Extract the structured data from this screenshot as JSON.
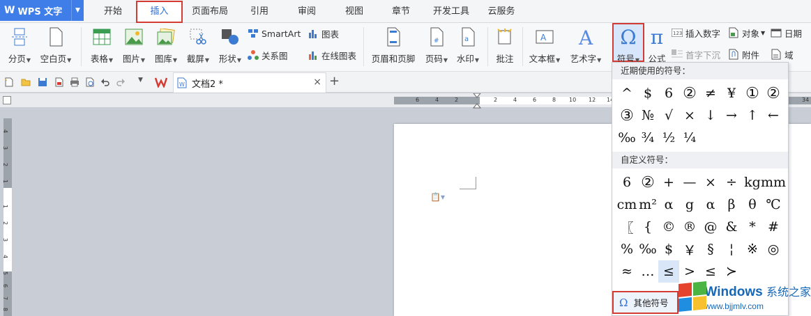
{
  "app": {
    "name": "WPS 文字",
    "logo": "W"
  },
  "menu_tabs": [
    "开始",
    "插入",
    "页面布局",
    "引用",
    "审阅",
    "视图",
    "章节",
    "开发工具",
    "云服务"
  ],
  "active_tab": "插入",
  "ribbon": {
    "blank": "分页",
    "blank_page": "空白页",
    "table": "表格",
    "picture": "图片",
    "gallery": "图库",
    "screenshot": "截屏",
    "shape": "形状",
    "smartart": "SmartArt",
    "relation": "关系图",
    "chart": "图表",
    "online_chart": "在线图表",
    "header_footer": "页眉和页脚",
    "page_num": "页码",
    "watermark": "水印",
    "comment": "批注",
    "textbox": "文本框",
    "wordart": "艺术字",
    "symbol": "符号",
    "formula": "公式",
    "insert_number": "插入数字",
    "drop_cap": "首字下沉",
    "object": "对象",
    "attachment": "附件",
    "date": "日期",
    "field": "域"
  },
  "document_tab": {
    "name": "文档2 *",
    "close": "×",
    "new": "+"
  },
  "ruler": {
    "h_numbers": [
      "6",
      "4",
      "2",
      "2",
      "4",
      "6",
      "8",
      "10",
      "12",
      "14",
      "34"
    ],
    "v_numbers": [
      "4",
      "3",
      "2",
      "1",
      "1",
      "2",
      "3",
      "4",
      "5",
      "6",
      "7",
      "8"
    ]
  },
  "symbol_panel": {
    "recent_title": "近期使用的符号：",
    "recent": [
      "^",
      "$",
      "6",
      "②",
      "≠",
      "¥",
      "①",
      "②",
      "③",
      "№",
      "√",
      "×",
      "↓",
      "→",
      "↑",
      "←",
      "‰",
      "¾",
      "½",
      "¼"
    ],
    "custom_title": "自定义符号：",
    "custom": [
      "6",
      "②",
      "+",
      "—",
      "×",
      "÷",
      "kg",
      "mm",
      "cm",
      "m²",
      "α",
      "g",
      "α",
      "β",
      "θ",
      "℃",
      "〖",
      "{",
      "©",
      "®",
      "@",
      "&",
      "*",
      "#",
      "%",
      "‰",
      "$",
      "￥",
      "§",
      "¦",
      "※",
      "◎",
      "≈",
      "…",
      "≤",
      ">",
      "≤",
      "≻"
    ],
    "other": "其他符号",
    "other_icon": "Ω"
  },
  "watermark": {
    "title": "Windows",
    "title_cn": "系统之家",
    "url": "www.bjjmlv.com"
  }
}
